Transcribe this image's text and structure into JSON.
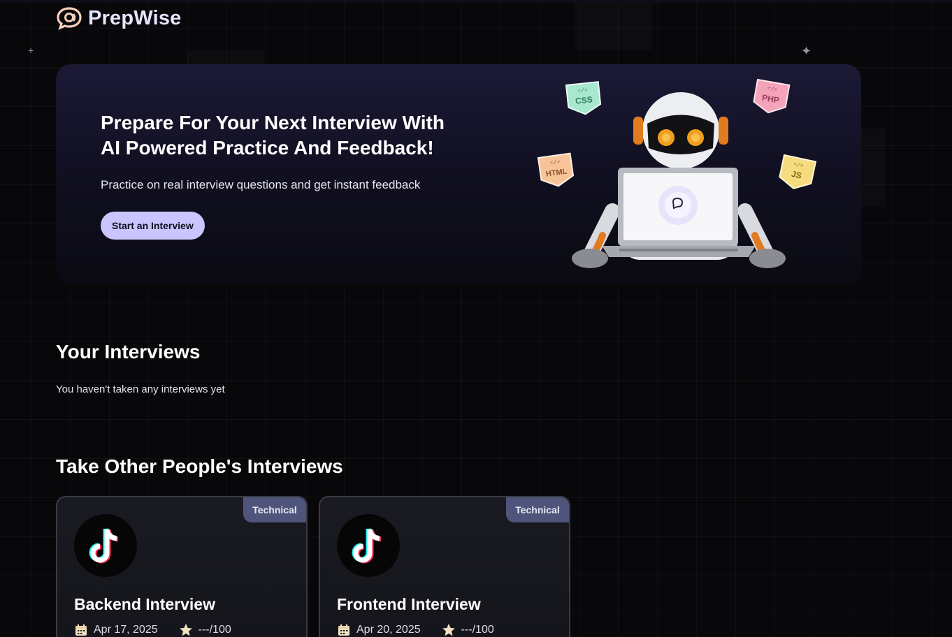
{
  "app": {
    "name": "PrepWise"
  },
  "hero": {
    "title_line1": "Prepare For Your Next Interview With",
    "title_line2": "AI Powered Practice And Feedback!",
    "subtitle": "Practice on real interview questions and get instant feedback",
    "cta_label": "Start an Interview",
    "tech_badges": [
      "CSS",
      "PHP",
      "HTML",
      "JS"
    ]
  },
  "your_interviews": {
    "title": "Your Interviews",
    "empty_message": "You haven't taken any interviews yet"
  },
  "other_interviews": {
    "title": "Take Other People's Interviews",
    "cards": [
      {
        "type": "Technical",
        "title": "Backend Interview",
        "date": "Apr 17, 2025",
        "score": "---/100",
        "icon": "tiktok-logo-icon"
      },
      {
        "type": "Technical",
        "title": "Frontend Interview",
        "date": "Apr 20, 2025",
        "score": "---/100",
        "icon": "tiktok-logo-icon"
      }
    ]
  },
  "colors": {
    "accent": "#cac5fe",
    "background": "#08080a",
    "badge": "#4f557a",
    "logo": "#e8e4ff"
  }
}
